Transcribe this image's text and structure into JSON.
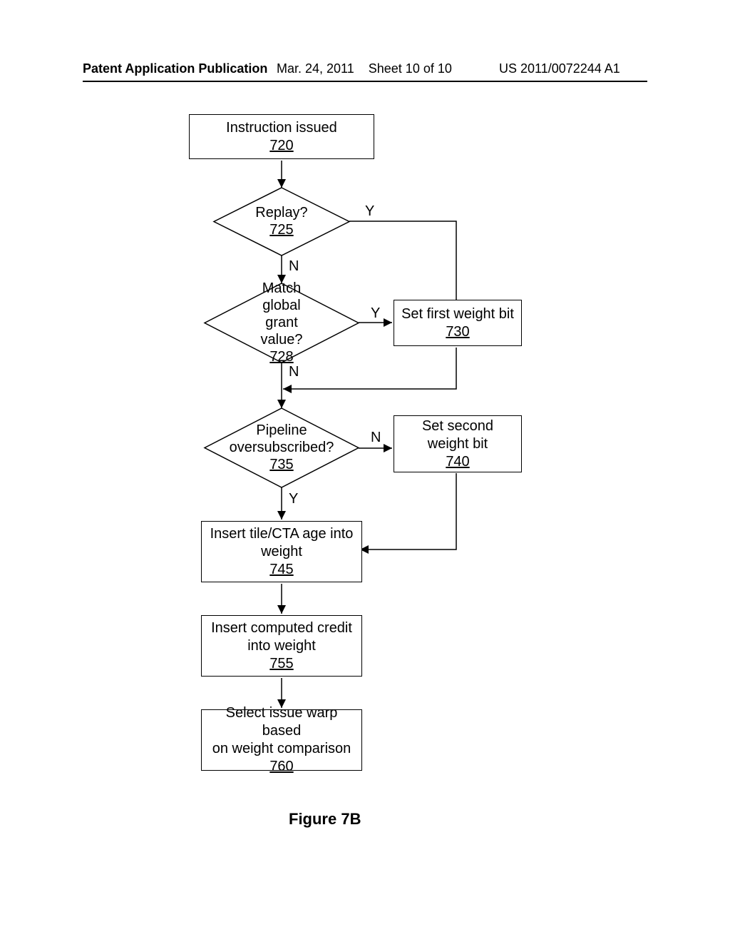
{
  "header": {
    "left": "Patent Application Publication",
    "mid_date": "Mar. 24, 2011",
    "mid_sheet": "Sheet 10 of 10",
    "right": "US 2011/0072244 A1"
  },
  "figure_caption": "Figure 7B",
  "labels": {
    "Y": "Y",
    "N": "N"
  },
  "nodes": {
    "n720": {
      "text": "Instruction issued",
      "ref": "720"
    },
    "n725": {
      "text": "Replay?",
      "ref": "725"
    },
    "n728": {
      "text1": "Match",
      "text2": "global grant value?",
      "ref": "728"
    },
    "n730": {
      "text": "Set first weight bit",
      "ref": "730"
    },
    "n735": {
      "text1": "Pipeline",
      "text2": "oversubscribed?",
      "ref": "735"
    },
    "n740": {
      "text1": "Set second",
      "text2": "weight bit",
      "ref": "740"
    },
    "n745": {
      "text1": "Insert tile/CTA age into",
      "text2": "weight",
      "ref": "745"
    },
    "n755": {
      "text1": "Insert computed credit",
      "text2": "into weight",
      "ref": "755"
    },
    "n760": {
      "text1": "Select issue warp based",
      "text2": "on weight comparison",
      "ref": "760"
    }
  }
}
